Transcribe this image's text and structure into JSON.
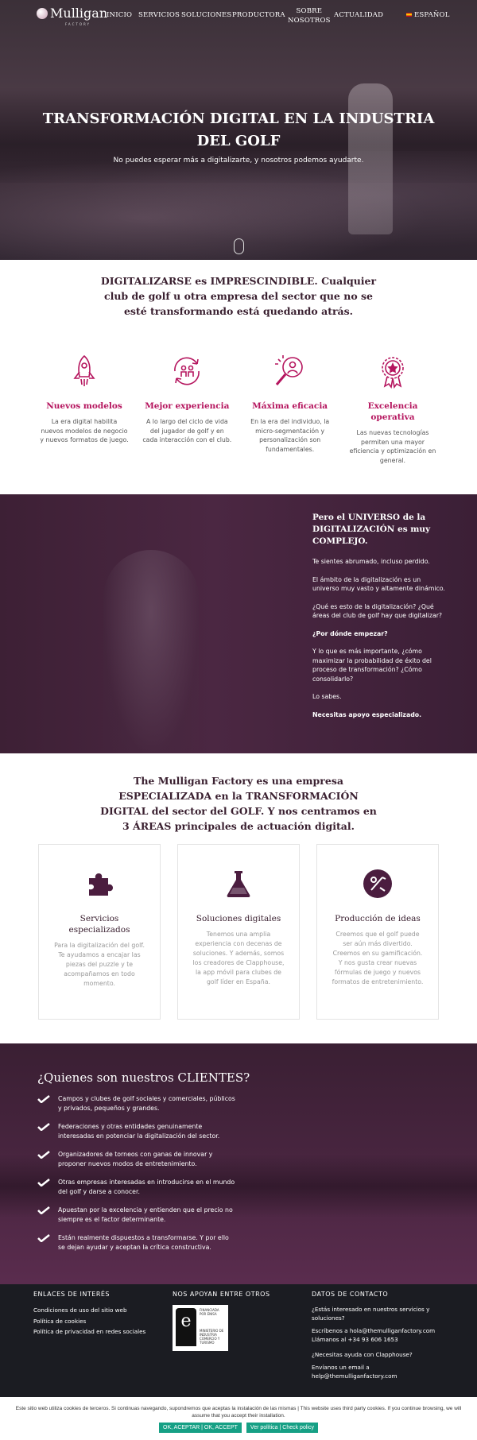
{
  "nav": {
    "logo_name": "Mulligan",
    "logo_sub": "FACTORY",
    "items": [
      "INICIO",
      "SERVICIOS",
      "SOLUCIONES",
      "PRODUCTORA",
      "SOBRE",
      "NOSOTROS",
      "ACTUALIDAD"
    ],
    "language": "ESPAÑOL"
  },
  "hero": {
    "title": "TRANSFORMACIÓN DIGITAL EN LA INDUSTRIA DEL GOLF",
    "subtitle": "No puedes esperar más a digitalizarte, y nosotros podemos ayudarte."
  },
  "intro": "DIGITALIZARSE es IMPRESCINDIBLE. Cualquier club de golf u otra empresa del sector que no se esté transformando está quedando atrás.",
  "features": [
    {
      "icon": "rocket-icon",
      "title": "Nuevos modelos",
      "text": "La era digital habilita nuevos modelos de negocio y nuevos formatos de juego."
    },
    {
      "icon": "experience-cycle-icon",
      "title": "Mejor experiencia",
      "text": "A lo largo del ciclo de vida del jugador de golf y en cada interacción con el club."
    },
    {
      "icon": "magnifier-user-icon",
      "title": "Máxima eficacia",
      "text": "En la era del individuo, la micro-segmentación y personalización son fundamentales."
    },
    {
      "icon": "medal-icon",
      "title": "Excelencia operativa",
      "text": "Las nuevas tecnologías permiten una mayor eficiencia y optimización en general."
    }
  ],
  "universe": {
    "title": "Pero el UNIVERSO de la DIGITALIZACIÓN es muy COMPLEJO.",
    "paragraphs": [
      "Te sientes abrumado, incluso perdido.",
      "El ámbito de la digitalización es un universo muy vasto y altamente dinámico.",
      "¿Qué es esto de la digitalización? ¿Qué áreas del club de golf hay que digitalizar?",
      "¿Por dónde empezar?",
      "Y lo que es más importante, ¿cómo maximizar la probabilidad de éxito del proceso de transformación? ¿Cómo consolidarlo?",
      "Lo sabes.",
      "Necesitas apoyo especializado."
    ]
  },
  "spec": "The Mulligan Factory es una empresa ESPECIALIZADA en la TRANSFORMACIÓN DIGITAL del sector del GOLF. Y nos centramos en 3 ÁREAS principales de actuación digital.",
  "cards": [
    {
      "icon": "puzzle-icon",
      "title": "Servicios especializados",
      "text": "Para la digitalización del golf. Te ayudamos a encajar las piezas del puzzle y te acompañamos en todo momento."
    },
    {
      "icon": "flask-icon",
      "title": "Soluciones digitales",
      "text": "Tenemos una amplia experiencia con decenas de soluciones. Y además, somos los creadores de Clapphouse, la app móvil para clubes de golf líder en España."
    },
    {
      "icon": "golf-idea-icon",
      "title": "Producción de ideas",
      "text": "Creemos que el golf puede ser aún más divertido. Creemos en su gamificación. Y nos gusta crear nuevas fórmulas de juego y nuevos formatos de entretenimiento."
    }
  ],
  "clients": {
    "title": "¿Quienes son nuestros CLIENTES?",
    "items": [
      "Campos y clubes de golf sociales y comerciales, públicos y privados, pequeños y grandes.",
      "Federaciones y otras entidades genuinamente interesadas en potenciar la digitalización del sector.",
      "Organizadores de torneos con ganas de innovar y proponer nuevos modos de entretenimiento.",
      "Otras empresas interesadas en introducirse en el mundo del golf y darse a conocer.",
      "Apuestan por la excelencia y entienden que el precio no siempre es el factor determinante.",
      "Están realmente dispuestos a transformarse. Y por ello se dejan ayudar y aceptan la crítica constructiva."
    ]
  },
  "footer": {
    "links_title": "ENLACES DE INTERÉS",
    "links": [
      "Condiciones de uso del sitio web",
      "Política de cookies",
      "Política de privacidad en redes sociales"
    ],
    "support_title": "NOS APOYAN ENTRE OTROS",
    "enisa_top": "FINANCIADA POR ENISA",
    "enisa_bottom": "MINISTERIO DE INDUSTRIA COMERCIO Y TURISMO",
    "contact_title": "DATOS DE CONTACTO",
    "contact_q1": "¿Estás interesado en nuestros servicios y soluciones?",
    "contact_email_line": "Escríbenos a hola@themulliganfactory.com",
    "contact_phone_line": "Llámanos al +34 93 606 1653",
    "contact_q2": "¿Necesitas ayuda con Clapphouse?",
    "contact_help_line": "Envíanos un email a help@themulliganfactory.com"
  },
  "cookie": {
    "message": "Este sitio web utiliza cookies de terceros. Si continuas navegando, supondremos que aceptas la instalación de las mismas | This website uses third party cookies. If you continue browsing, we will assume that you accept their installation.",
    "accept": "OK, ACEPTAR | OK, ACCEPT",
    "policy": "Ver política | Check policy"
  },
  "colors": {
    "accent": "#b5155e",
    "brand_dark": "#4b2742",
    "cookie_button": "#16a085"
  }
}
